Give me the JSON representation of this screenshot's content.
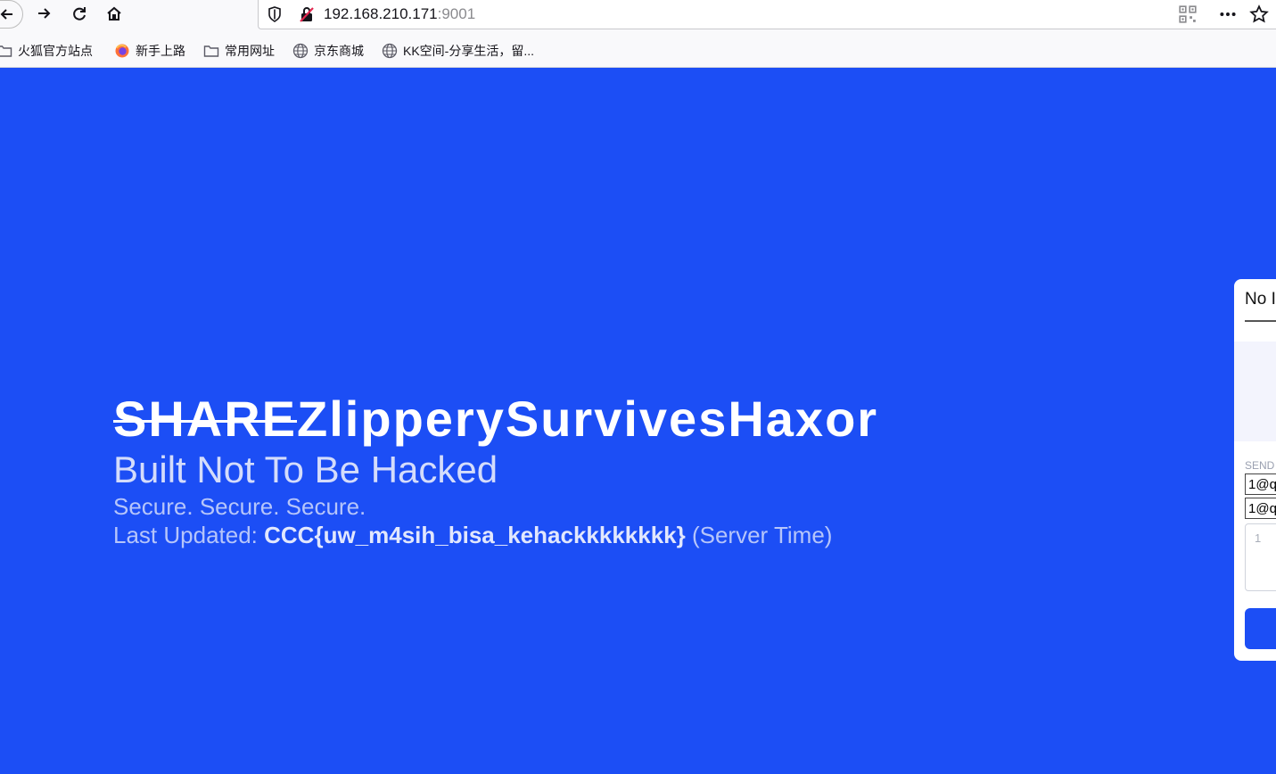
{
  "browser": {
    "url_host": "192.168.210.171",
    "url_port": ":9001",
    "bookmarks": [
      {
        "label": "火狐官方站点",
        "icon": "folder-icon"
      },
      {
        "label": "新手上路",
        "icon": "firefox-icon"
      },
      {
        "label": "常用网址",
        "icon": "folder-icon"
      },
      {
        "label": "京东商城",
        "icon": "globe-icon"
      },
      {
        "label": "KK空间-分享生活，留...",
        "icon": "globe-icon"
      }
    ]
  },
  "hero": {
    "title_struck": "SHARE",
    "title_rest": "ZlipperySurvivesHaxor",
    "subtitle": "Built Not To Be Hacked",
    "tagline": "Secure. Secure. Secure.",
    "updated_prefix": "Last Updated: ",
    "updated_value": "CCC{uw_m4sih_bisa_kehackkkkkkkk}",
    "updated_suffix": " (Server Time)"
  },
  "panel": {
    "title": "No I",
    "label": "SEND",
    "input1": "1@q",
    "input2": "1@q",
    "textarea_placeholder": "1"
  },
  "colors": {
    "page_background": "#1c4ef5",
    "panel_background": "#ffffff"
  }
}
